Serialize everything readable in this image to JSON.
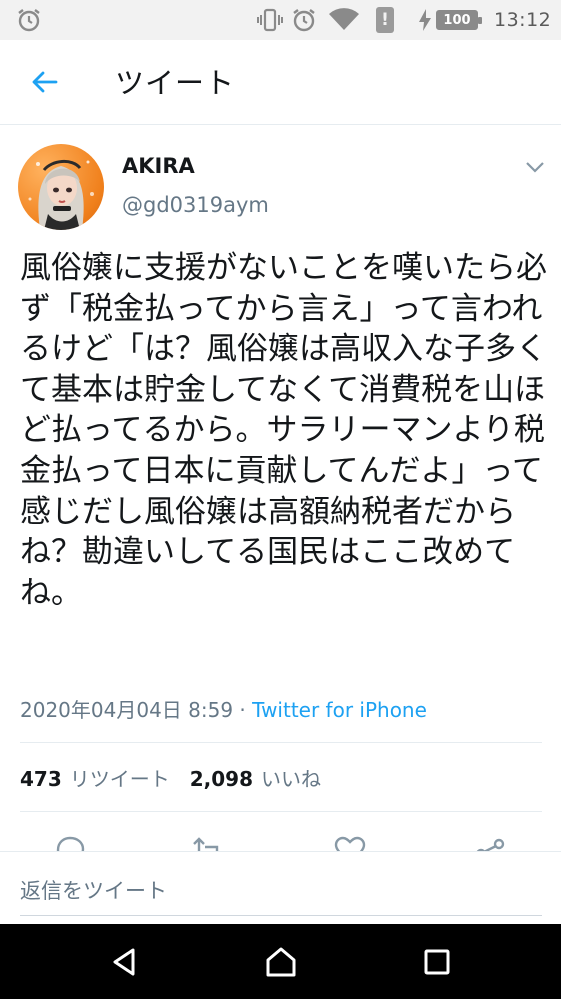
{
  "status_bar": {
    "time": "13:12",
    "battery": "100"
  },
  "header": {
    "title": "ツイート"
  },
  "tweet": {
    "author_name": "AKIRA",
    "author_handle": "@gd0319aym",
    "text": "風俗嬢に支援がないことを嘆いたら必ず「税金払ってから言え」って言われるけど「は？風俗嬢は高収入な子多くて基本は貯金してなくて消費税を山ほど払ってるから。サラリーマンより税金払って日本に貢献してんだよ」って感じだし風俗嬢は高額納税者だからね？勘違いしてる国民はここ改めてね。",
    "timestamp": "2020年04月04日 8:59",
    "separator": " · ",
    "source": "Twitter for iPhone",
    "retweet_count": "473",
    "retweet_label": "リツイート",
    "like_count": "2,098",
    "like_label": "いいね"
  },
  "reply": {
    "placeholder": "返信をツイート"
  },
  "colors": {
    "accent": "#1da1f2",
    "text": "#14171a",
    "secondary": "#657786",
    "divider": "#e6ecf0"
  }
}
